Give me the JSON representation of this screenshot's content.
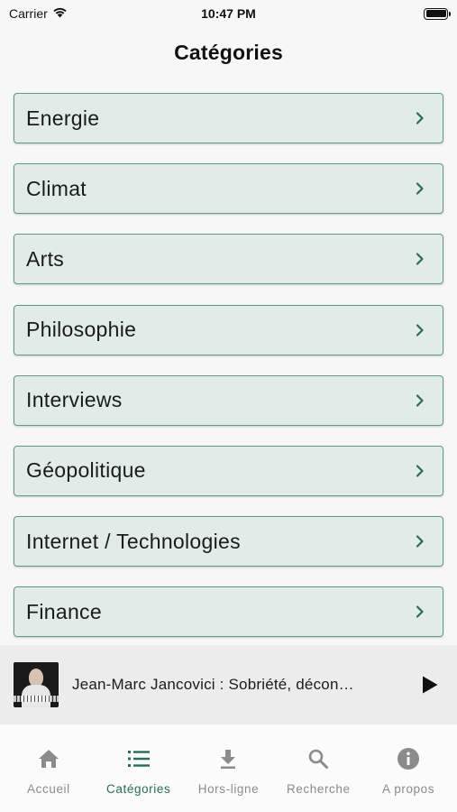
{
  "status_bar": {
    "carrier": "Carrier",
    "time": "10:47 PM"
  },
  "header": {
    "title": "Catégories"
  },
  "categories": [
    {
      "label": "Energie"
    },
    {
      "label": "Climat"
    },
    {
      "label": "Arts"
    },
    {
      "label": "Philosophie"
    },
    {
      "label": "Interviews"
    },
    {
      "label": "Géopolitique"
    },
    {
      "label": "Internet / Technologies"
    },
    {
      "label": "Finance"
    }
  ],
  "player": {
    "title": "Jean-Marc Jancovici : Sobriété, décon…"
  },
  "tabs": [
    {
      "label": "Accueil",
      "icon": "home-icon"
    },
    {
      "label": "Catégories",
      "icon": "list-icon",
      "active": true
    },
    {
      "label": "Hors-ligne",
      "icon": "download-icon"
    },
    {
      "label": "Recherche",
      "icon": "search-icon"
    },
    {
      "label": "A propos",
      "icon": "info-icon"
    }
  ],
  "colors": {
    "accent": "#256e5c",
    "card_background": "#e1ebe8",
    "card_border": "#5e9c88",
    "inactive": "#8b8b8b"
  }
}
